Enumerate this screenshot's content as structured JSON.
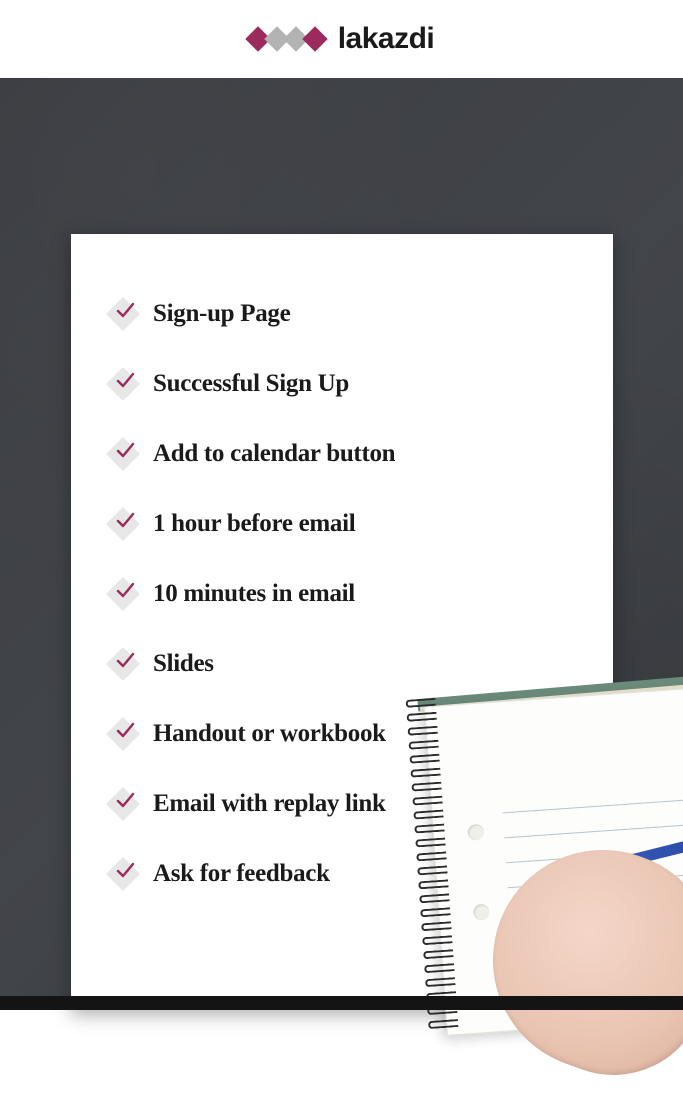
{
  "brand": {
    "name": "lakazdi",
    "diamond_colors": [
      "magenta",
      "gray",
      "gray",
      "magenta"
    ]
  },
  "checklist": {
    "items": [
      {
        "label": "Sign-up Page",
        "checked": true
      },
      {
        "label": "Successful Sign Up",
        "checked": true
      },
      {
        "label": "Add to calendar button",
        "checked": true
      },
      {
        "label": "1 hour before email",
        "checked": true
      },
      {
        "label": "10 minutes in email",
        "checked": true
      },
      {
        "label": "Slides",
        "checked": true
      },
      {
        "label": "Handout or workbook",
        "checked": true
      },
      {
        "label": "Email with replay link",
        "checked": true
      },
      {
        "label": "Ask for feedback",
        "checked": true
      }
    ]
  },
  "colors": {
    "accent": "#9d2a5c",
    "muted": "#b3b3b3",
    "background": "#3e4045"
  }
}
